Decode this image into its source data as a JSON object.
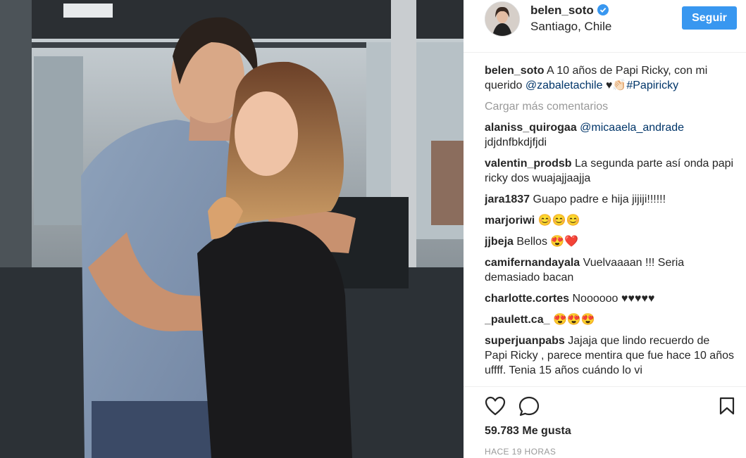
{
  "post": {
    "username": "belen_soto",
    "location": "Santiago, Chile",
    "follow_label": "Seguir",
    "caption": {
      "username": "belen_soto",
      "text_before": "A 10 años de Papi Ricky, con mi querido",
      "mention": "@zabaletachile",
      "symbols": "♥👏🏻",
      "hashtag": "#Papiricky"
    },
    "load_more_label": "Cargar más comentarios",
    "likes_label": "59.783 Me gusta",
    "time_label": "HACE 19 HORAS"
  },
  "comments": [
    {
      "user": "alaniss_quirogaa",
      "mention": "@micaaela_andrade",
      "text": "jdjdnfbkdjfjdi"
    },
    {
      "user": "valentin_prodsb",
      "text": "La segunda parte así onda papi ricky dos wuajajjaajja"
    },
    {
      "user": "jara1837",
      "text": "Guapo padre e hija jijiji!!!!!!"
    },
    {
      "user": "marjoriwi",
      "text": "😊😊😊"
    },
    {
      "user": "jjbeja",
      "text": "Bellos 😍❤️"
    },
    {
      "user": "camifernandayala",
      "text": "Vuelvaaaan !!! Seria demasiado bacan"
    },
    {
      "user": "charlotte.cortes",
      "text": "Noooooo ♥♥♥♥♥"
    },
    {
      "user": "_paulett.ca_",
      "text": "😍😍😍"
    },
    {
      "user": "superjuanpabs",
      "text": "Jajaja que lindo recuerdo de Papi Ricky , parece mentira que fue hace 10 años uffff. Tenia 15 años cuándo lo vi"
    }
  ],
  "icons": {
    "like": "heart-outline",
    "comment": "speech-bubble",
    "save": "bookmark-outline",
    "verified": "blue-check-badge"
  },
  "colors": {
    "accent": "#3897f0",
    "link": "#003569",
    "muted": "#999999"
  }
}
